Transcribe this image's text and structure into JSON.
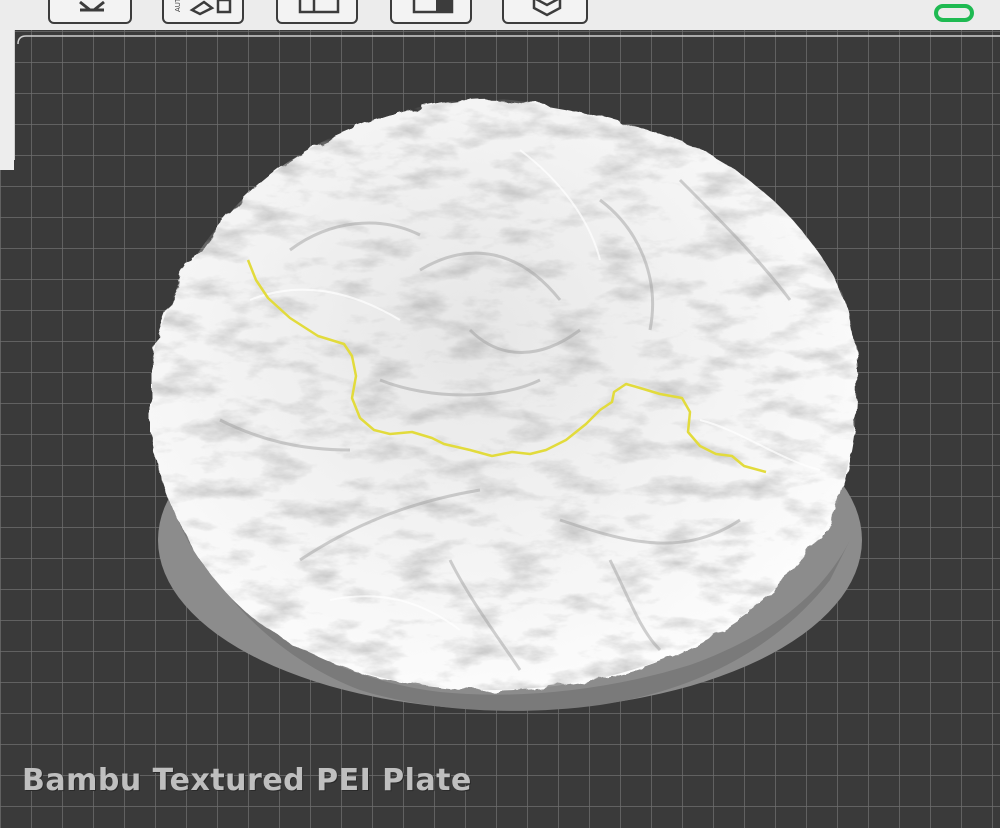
{
  "toolbar": {
    "buttons": [
      {
        "name": "arrange-tool-button",
        "icon": "arrange-icon"
      },
      {
        "name": "auto-orient-tool-button",
        "icon": "auto-orient-icon",
        "icon_text": "AUTO"
      },
      {
        "name": "layout-tool-button",
        "icon": "layout-icon"
      },
      {
        "name": "split-tool-button",
        "icon": "split-icon"
      },
      {
        "name": "support-tool-button",
        "icon": "hexagon-icon"
      }
    ],
    "status_color": "#1fba52"
  },
  "plate": {
    "label": "Bambu Textured PEI Plate",
    "grid_color": "#6e6e6e",
    "bed_color": "#3a3a3a"
  },
  "model": {
    "surface_color": "#f2f2f2",
    "base_color": "#8c8c8c",
    "trail_color": "#e2db3c"
  }
}
